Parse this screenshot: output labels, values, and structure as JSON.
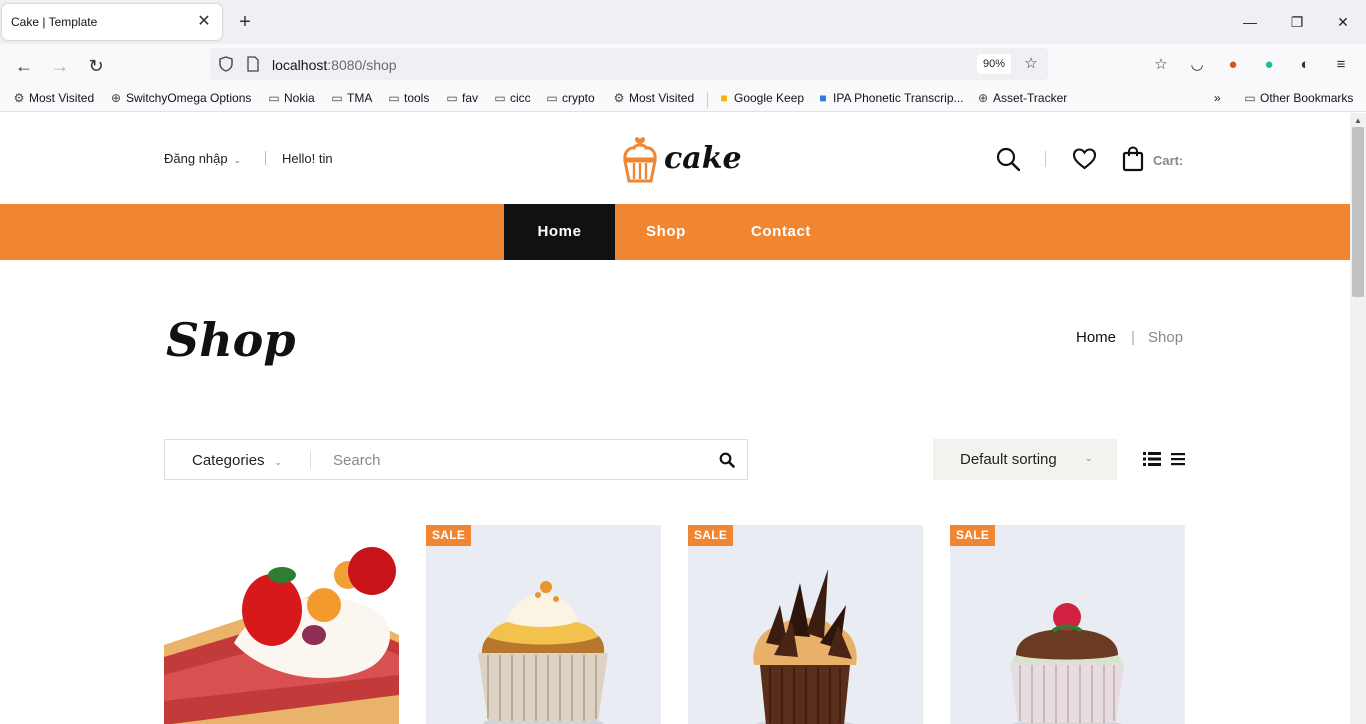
{
  "browser": {
    "tab_title": "Cake | Template",
    "url_host": "localhost",
    "url_path": ":8080/shop",
    "zoom": "90%",
    "bookmarks": [
      {
        "label": "Most Visited",
        "icon": "gear-icon"
      },
      {
        "label": "SwitchyOmega Options",
        "icon": "globe-icon"
      },
      {
        "label": "Nokia",
        "icon": "folder-icon"
      },
      {
        "label": "TMA",
        "icon": "folder-icon"
      },
      {
        "label": "tools",
        "icon": "folder-icon"
      },
      {
        "label": "fav",
        "icon": "folder-icon"
      },
      {
        "label": "cicc",
        "icon": "folder-icon"
      },
      {
        "label": "crypto",
        "icon": "folder-icon"
      },
      {
        "label": "Most Visited",
        "icon": "gear-icon"
      },
      {
        "label": "Google Keep",
        "icon": "keep-icon"
      },
      {
        "label": "IPA Phonetic Transcrip...",
        "icon": "ipa-icon"
      },
      {
        "label": "Asset-Tracker",
        "icon": "globe-icon"
      }
    ],
    "other_bookmarks": "Other Bookmarks"
  },
  "header": {
    "login_label": "Đăng nhập",
    "greeting": "Hello!  tin",
    "logo_text": "cake",
    "cart_label": "Cart:"
  },
  "nav": {
    "items": [
      {
        "label": "Home",
        "active": true
      },
      {
        "label": "Shop",
        "active": false
      },
      {
        "label": "Contact",
        "active": false
      }
    ]
  },
  "page": {
    "title": "Shop",
    "breadcrumb": {
      "home": "Home",
      "separator": "|",
      "current": "Shop"
    }
  },
  "filters": {
    "categories_label": "Categories",
    "search_placeholder": "Search",
    "sort_label": "Default sorting"
  },
  "products": [
    {
      "image": "fruit-tart",
      "sale": false
    },
    {
      "image": "cupcake-yellow-frosting",
      "sale": true,
      "badge": "SALE"
    },
    {
      "image": "cupcake-chocolate-shavings",
      "sale": true,
      "badge": "SALE"
    },
    {
      "image": "cupcake-raspberry",
      "sale": true,
      "badge": "SALE"
    }
  ],
  "colors": {
    "accent": "#f08632",
    "nav_active": "#111111",
    "sort_bg": "#f3f2ee"
  }
}
